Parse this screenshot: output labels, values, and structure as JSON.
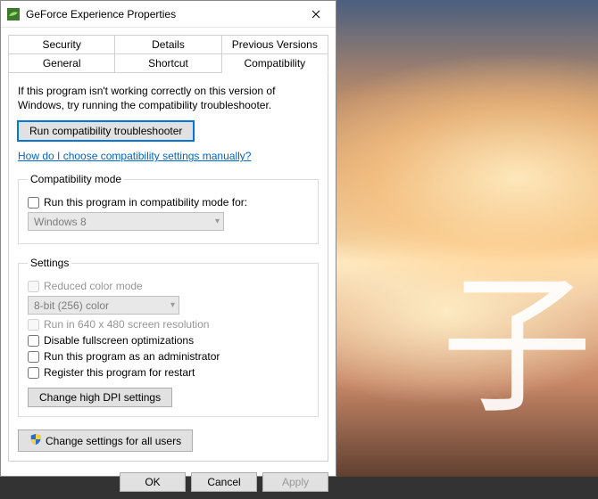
{
  "titlebar": {
    "title": "GeForce Experience Properties"
  },
  "tabs": {
    "row1": [
      "Security",
      "Details",
      "Previous Versions"
    ],
    "row2": [
      "General",
      "Shortcut",
      "Compatibility"
    ]
  },
  "body": {
    "help_text": "If this program isn't working correctly on this version of Windows, try running the compatibility troubleshooter.",
    "troubleshooter_btn": "Run compatibility troubleshooter",
    "manual_link": "How do I choose compatibility settings manually?"
  },
  "compat_mode": {
    "legend": "Compatibility mode",
    "checkbox": "Run this program in compatibility mode for:",
    "selected": "Windows 8"
  },
  "settings": {
    "legend": "Settings",
    "reduced_color": "Reduced color mode",
    "color_value": "8-bit (256) color",
    "low_res": "Run in 640 x 480 screen resolution",
    "disable_fullscreen": "Disable fullscreen optimizations",
    "run_admin": "Run this program as an administrator",
    "register_restart": "Register this program for restart",
    "dpi_btn": "Change high DPI settings"
  },
  "all_users_btn": "Change settings for all users",
  "buttons": {
    "ok": "OK",
    "cancel": "Cancel",
    "apply": "Apply"
  },
  "bg_glyph": "子"
}
